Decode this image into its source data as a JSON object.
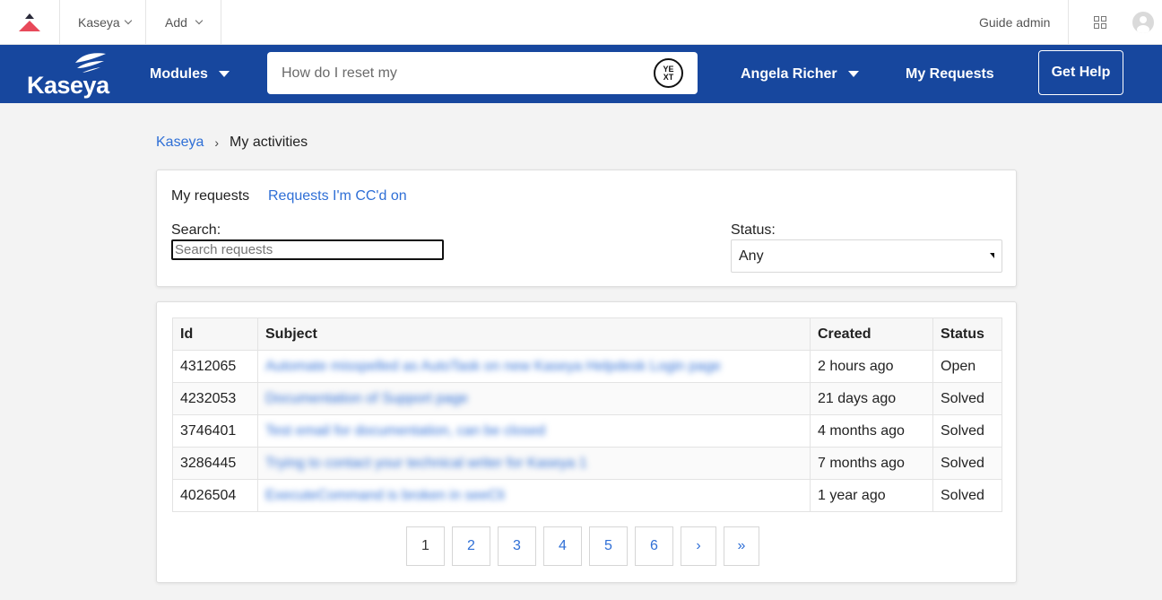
{
  "admin_bar": {
    "product_menu": "Kaseya",
    "add_menu": "Add",
    "guide_admin": "Guide admin"
  },
  "header": {
    "brand": "Kaseya",
    "modules": "Modules",
    "search": {
      "value": "How do I reset my"
    },
    "search_badge": [
      "YE",
      "XT"
    ],
    "user_menu": "Angela Richer",
    "my_requests": "My Requests",
    "get_help": "Get Help"
  },
  "breadcrumb": {
    "root": "Kaseya",
    "separator": "›",
    "current": "My activities"
  },
  "filters": {
    "tabs": [
      "My requests",
      "Requests I'm CC'd on"
    ],
    "search_label": "Search:",
    "search_placeholder": "Search requests",
    "status_label": "Status:",
    "status_value": "Any"
  },
  "requests_table": {
    "headers": [
      "Id",
      "Subject",
      "Created",
      "Status"
    ],
    "rows": [
      {
        "id": "4312065",
        "subject": "Automate misspelled as AutoTask on new Kaseya Helpdesk Login page",
        "created": "2 hours ago",
        "status": "Open"
      },
      {
        "id": "4232053",
        "subject": "Documentation of Support page",
        "created": "21 days ago",
        "status": "Solved"
      },
      {
        "id": "3746401",
        "subject": "Test email for documentation, can be closed",
        "created": "4 months ago",
        "status": "Solved"
      },
      {
        "id": "3286445",
        "subject": "Trying to contact your technical writer for Kaseya 1",
        "created": "7 months ago",
        "status": "Solved"
      },
      {
        "id": "4026504",
        "subject": "ExecuteCommand is broken in seeCli",
        "created": "1 year ago",
        "status": "Solved"
      }
    ]
  },
  "pagination": {
    "pages": [
      "1",
      "2",
      "3",
      "4",
      "5",
      "6"
    ],
    "current": "1",
    "next": "›",
    "last": "»"
  },
  "colors": {
    "header_bg": "#17479e",
    "link": "#2f6fd6",
    "page_bg": "#f3f3f3"
  }
}
